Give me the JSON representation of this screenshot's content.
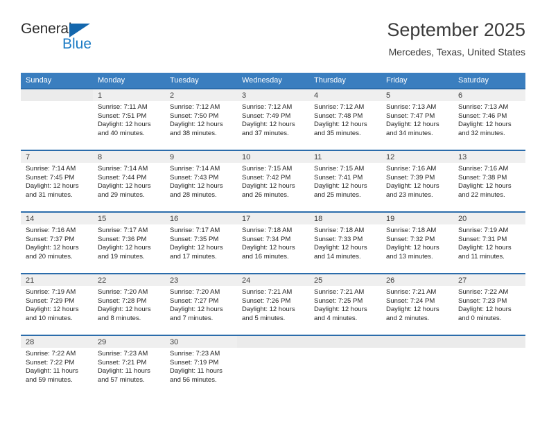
{
  "brand": {
    "name_part1": "General",
    "name_part2": "Blue",
    "triangle_icon": "triangle-icon",
    "accent_color": "#1a7ac4",
    "triangle_color": "#1467ad"
  },
  "header": {
    "title": "September 2025",
    "location": "Mercedes, Texas, United States"
  },
  "theme": {
    "header_row_bg": "#3a7ebf",
    "row_top_border": "#2b6cab",
    "daynum_strip_bg": "#efefef",
    "text_color": "#1f1f1f"
  },
  "calendar": {
    "weekday_headers": [
      "Sunday",
      "Monday",
      "Tuesday",
      "Wednesday",
      "Thursday",
      "Friday",
      "Saturday"
    ],
    "weeks": [
      [
        {
          "day": "",
          "sunrise": "",
          "sunset": "",
          "daylight_line1": "",
          "daylight_line2": "",
          "empty": true
        },
        {
          "day": "1",
          "sunrise": "Sunrise: 7:11 AM",
          "sunset": "Sunset: 7:51 PM",
          "daylight_line1": "Daylight: 12 hours",
          "daylight_line2": "and 40 minutes."
        },
        {
          "day": "2",
          "sunrise": "Sunrise: 7:12 AM",
          "sunset": "Sunset: 7:50 PM",
          "daylight_line1": "Daylight: 12 hours",
          "daylight_line2": "and 38 minutes."
        },
        {
          "day": "3",
          "sunrise": "Sunrise: 7:12 AM",
          "sunset": "Sunset: 7:49 PM",
          "daylight_line1": "Daylight: 12 hours",
          "daylight_line2": "and 37 minutes."
        },
        {
          "day": "4",
          "sunrise": "Sunrise: 7:12 AM",
          "sunset": "Sunset: 7:48 PM",
          "daylight_line1": "Daylight: 12 hours",
          "daylight_line2": "and 35 minutes."
        },
        {
          "day": "5",
          "sunrise": "Sunrise: 7:13 AM",
          "sunset": "Sunset: 7:47 PM",
          "daylight_line1": "Daylight: 12 hours",
          "daylight_line2": "and 34 minutes."
        },
        {
          "day": "6",
          "sunrise": "Sunrise: 7:13 AM",
          "sunset": "Sunset: 7:46 PM",
          "daylight_line1": "Daylight: 12 hours",
          "daylight_line2": "and 32 minutes."
        }
      ],
      [
        {
          "day": "7",
          "sunrise": "Sunrise: 7:14 AM",
          "sunset": "Sunset: 7:45 PM",
          "daylight_line1": "Daylight: 12 hours",
          "daylight_line2": "and 31 minutes."
        },
        {
          "day": "8",
          "sunrise": "Sunrise: 7:14 AM",
          "sunset": "Sunset: 7:44 PM",
          "daylight_line1": "Daylight: 12 hours",
          "daylight_line2": "and 29 minutes."
        },
        {
          "day": "9",
          "sunrise": "Sunrise: 7:14 AM",
          "sunset": "Sunset: 7:43 PM",
          "daylight_line1": "Daylight: 12 hours",
          "daylight_line2": "and 28 minutes."
        },
        {
          "day": "10",
          "sunrise": "Sunrise: 7:15 AM",
          "sunset": "Sunset: 7:42 PM",
          "daylight_line1": "Daylight: 12 hours",
          "daylight_line2": "and 26 minutes."
        },
        {
          "day": "11",
          "sunrise": "Sunrise: 7:15 AM",
          "sunset": "Sunset: 7:41 PM",
          "daylight_line1": "Daylight: 12 hours",
          "daylight_line2": "and 25 minutes."
        },
        {
          "day": "12",
          "sunrise": "Sunrise: 7:16 AM",
          "sunset": "Sunset: 7:39 PM",
          "daylight_line1": "Daylight: 12 hours",
          "daylight_line2": "and 23 minutes."
        },
        {
          "day": "13",
          "sunrise": "Sunrise: 7:16 AM",
          "sunset": "Sunset: 7:38 PM",
          "daylight_line1": "Daylight: 12 hours",
          "daylight_line2": "and 22 minutes."
        }
      ],
      [
        {
          "day": "14",
          "sunrise": "Sunrise: 7:16 AM",
          "sunset": "Sunset: 7:37 PM",
          "daylight_line1": "Daylight: 12 hours",
          "daylight_line2": "and 20 minutes."
        },
        {
          "day": "15",
          "sunrise": "Sunrise: 7:17 AM",
          "sunset": "Sunset: 7:36 PM",
          "daylight_line1": "Daylight: 12 hours",
          "daylight_line2": "and 19 minutes."
        },
        {
          "day": "16",
          "sunrise": "Sunrise: 7:17 AM",
          "sunset": "Sunset: 7:35 PM",
          "daylight_line1": "Daylight: 12 hours",
          "daylight_line2": "and 17 minutes."
        },
        {
          "day": "17",
          "sunrise": "Sunrise: 7:18 AM",
          "sunset": "Sunset: 7:34 PM",
          "daylight_line1": "Daylight: 12 hours",
          "daylight_line2": "and 16 minutes."
        },
        {
          "day": "18",
          "sunrise": "Sunrise: 7:18 AM",
          "sunset": "Sunset: 7:33 PM",
          "daylight_line1": "Daylight: 12 hours",
          "daylight_line2": "and 14 minutes."
        },
        {
          "day": "19",
          "sunrise": "Sunrise: 7:18 AM",
          "sunset": "Sunset: 7:32 PM",
          "daylight_line1": "Daylight: 12 hours",
          "daylight_line2": "and 13 minutes."
        },
        {
          "day": "20",
          "sunrise": "Sunrise: 7:19 AM",
          "sunset": "Sunset: 7:31 PM",
          "daylight_line1": "Daylight: 12 hours",
          "daylight_line2": "and 11 minutes."
        }
      ],
      [
        {
          "day": "21",
          "sunrise": "Sunrise: 7:19 AM",
          "sunset": "Sunset: 7:29 PM",
          "daylight_line1": "Daylight: 12 hours",
          "daylight_line2": "and 10 minutes."
        },
        {
          "day": "22",
          "sunrise": "Sunrise: 7:20 AM",
          "sunset": "Sunset: 7:28 PM",
          "daylight_line1": "Daylight: 12 hours",
          "daylight_line2": "and 8 minutes."
        },
        {
          "day": "23",
          "sunrise": "Sunrise: 7:20 AM",
          "sunset": "Sunset: 7:27 PM",
          "daylight_line1": "Daylight: 12 hours",
          "daylight_line2": "and 7 minutes."
        },
        {
          "day": "24",
          "sunrise": "Sunrise: 7:21 AM",
          "sunset": "Sunset: 7:26 PM",
          "daylight_line1": "Daylight: 12 hours",
          "daylight_line2": "and 5 minutes."
        },
        {
          "day": "25",
          "sunrise": "Sunrise: 7:21 AM",
          "sunset": "Sunset: 7:25 PM",
          "daylight_line1": "Daylight: 12 hours",
          "daylight_line2": "and 4 minutes."
        },
        {
          "day": "26",
          "sunrise": "Sunrise: 7:21 AM",
          "sunset": "Sunset: 7:24 PM",
          "daylight_line1": "Daylight: 12 hours",
          "daylight_line2": "and 2 minutes."
        },
        {
          "day": "27",
          "sunrise": "Sunrise: 7:22 AM",
          "sunset": "Sunset: 7:23 PM",
          "daylight_line1": "Daylight: 12 hours",
          "daylight_line2": "and 0 minutes."
        }
      ],
      [
        {
          "day": "28",
          "sunrise": "Sunrise: 7:22 AM",
          "sunset": "Sunset: 7:22 PM",
          "daylight_line1": "Daylight: 11 hours",
          "daylight_line2": "and 59 minutes."
        },
        {
          "day": "29",
          "sunrise": "Sunrise: 7:23 AM",
          "sunset": "Sunset: 7:21 PM",
          "daylight_line1": "Daylight: 11 hours",
          "daylight_line2": "and 57 minutes."
        },
        {
          "day": "30",
          "sunrise": "Sunrise: 7:23 AM",
          "sunset": "Sunset: 7:19 PM",
          "daylight_line1": "Daylight: 11 hours",
          "daylight_line2": "and 56 minutes."
        },
        {
          "day": "",
          "sunrise": "",
          "sunset": "",
          "daylight_line1": "",
          "daylight_line2": "",
          "empty": true
        },
        {
          "day": "",
          "sunrise": "",
          "sunset": "",
          "daylight_line1": "",
          "daylight_line2": "",
          "empty": true
        },
        {
          "day": "",
          "sunrise": "",
          "sunset": "",
          "daylight_line1": "",
          "daylight_line2": "",
          "empty": true
        },
        {
          "day": "",
          "sunrise": "",
          "sunset": "",
          "daylight_line1": "",
          "daylight_line2": "",
          "empty": true
        }
      ]
    ]
  }
}
